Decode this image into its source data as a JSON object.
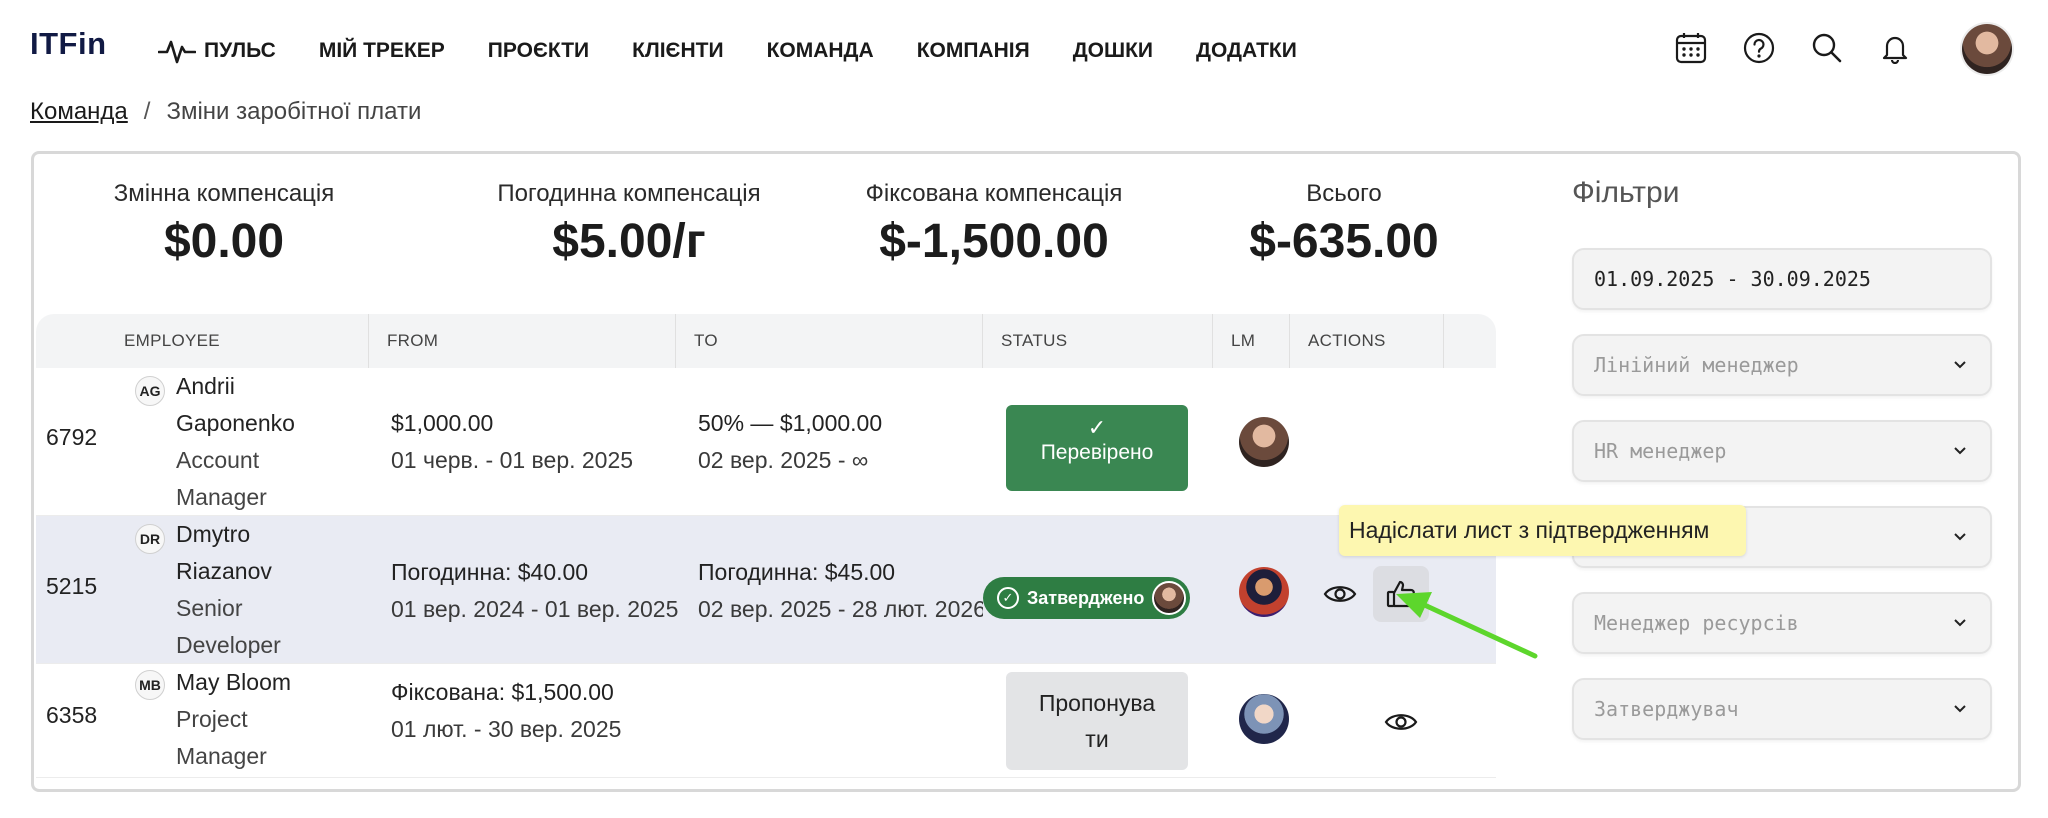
{
  "app": {
    "logo": "ITFin"
  },
  "nav": {
    "items": [
      {
        "label": "ПУЛЬС",
        "icon": "pulse-icon"
      },
      {
        "label": "МІЙ ТРЕКЕР"
      },
      {
        "label": "ПРОЄКТИ"
      },
      {
        "label": "КЛІЄНТИ"
      },
      {
        "label": "КОМАНДА"
      },
      {
        "label": "КОМПАНІЯ"
      },
      {
        "label": "ДОШКИ"
      },
      {
        "label": "ДОДАТКИ"
      }
    ],
    "icons": [
      "calendar-icon",
      "help-icon",
      "search-icon",
      "bell-icon",
      "user-avatar"
    ]
  },
  "breadcrumb": {
    "parent": "Команда",
    "separator": "/",
    "current": "Зміни заробітної плати"
  },
  "summary": [
    {
      "label": "Змінна компенсація",
      "value": "$0.00"
    },
    {
      "label": "Погодинна компенсація",
      "value": "$5.00/г"
    },
    {
      "label": "Фіксована компенсація",
      "value": "$-1,500.00"
    },
    {
      "label": "Всього",
      "value": "$-635.00"
    }
  ],
  "table": {
    "columns": [
      "EMPLOYEE",
      "FROM",
      "TO",
      "STATUS",
      "LM",
      "ACTIONS"
    ],
    "rows": [
      {
        "id": "6792",
        "initials": "AG",
        "name_lines": [
          "Andrii",
          "Gaponenko",
          "Account",
          "Manager"
        ],
        "from_value": "$1,000.00",
        "from_period": "01 черв. - 01 вер. 2025",
        "to_value": "50% — $1,000.00",
        "to_period": "02 вер. 2025 - ∞",
        "status": "Перевірено",
        "status_type": "verified"
      },
      {
        "id": "5215",
        "initials": "DR",
        "name_lines": [
          "Dmytro",
          "Riazanov",
          "Senior",
          "Developer"
        ],
        "from_value": "Погодинна: $40.00",
        "from_period": "01 вер. 2024 - 01 вер. 2025",
        "to_value": "Погодинна: $45.00",
        "to_period": "02 вер. 2025 - 28 лют. 2026",
        "status": "Затверджено",
        "status_type": "approved"
      },
      {
        "id": "6358",
        "initials": "MB",
        "name_lines": [
          "May Bloom",
          "Project",
          "Manager"
        ],
        "from_value": "Фіксована: $1,500.00",
        "from_period": "01 лют. - 30 вер. 2025",
        "to_value": "",
        "to_period": "",
        "status_lines": [
          "Пропонува",
          "ти"
        ],
        "status_type": "proposed"
      }
    ]
  },
  "tooltip": {
    "text": "Надіслати лист з підтвердженням"
  },
  "filters": {
    "title": "Фільтри",
    "date_range": "01.09.2025 - 30.09.2025",
    "selects": [
      "Лінійний менеджер",
      "HR менеджер",
      "",
      "Менеджер ресурсів",
      "Затверджувач"
    ]
  },
  "colors": {
    "verified": "#3a8752",
    "approved": "#2e7d43",
    "proposed": "#e3e4e6",
    "highlight_row": "#e9ebf3",
    "tooltip": "#fdf7b0",
    "arrow": "#5dd62c"
  }
}
